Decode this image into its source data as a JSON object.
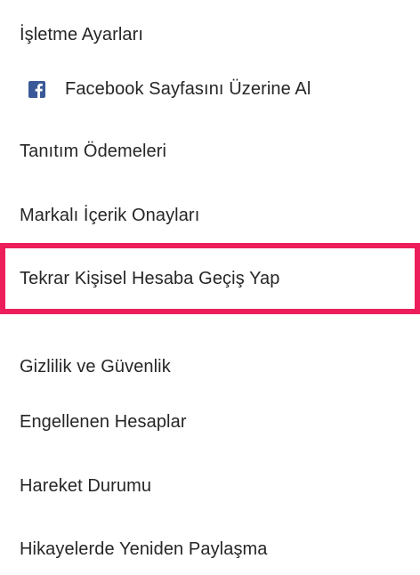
{
  "settings_menu": {
    "items": [
      {
        "label": "İşletme Ayarları"
      },
      {
        "label": "Facebook Sayfasını Üzerine Al",
        "icon": "facebook-icon"
      },
      {
        "label": "Tanıtım Ödemeleri"
      },
      {
        "label": "Markalı İçerik Onayları"
      },
      {
        "label": "Tekrar Kişisel Hesaba Geçiş Yap",
        "highlighted": true
      },
      {
        "label": "Gizlilik ve Güvenlik"
      },
      {
        "label": "Engellenen Hesaplar"
      },
      {
        "label": "Hareket Durumu"
      },
      {
        "label": "Hikayelerde Yeniden Paylaşma"
      }
    ]
  },
  "colors": {
    "highlight_border": "#ec1e5c",
    "facebook_blue": "#3b5998",
    "text": "#262626"
  }
}
